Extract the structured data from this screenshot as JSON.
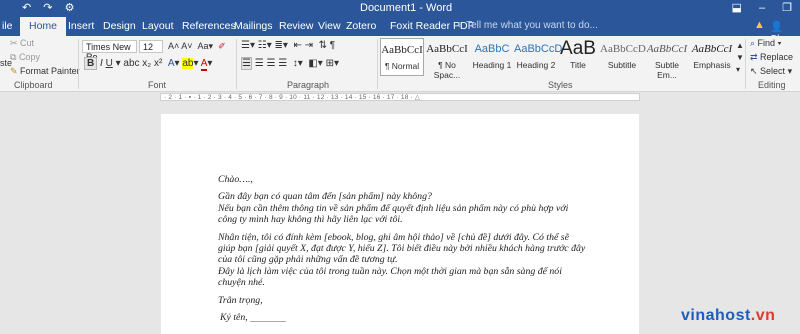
{
  "titlebar": {
    "document_title": "Document1 - Word",
    "quick_access": [
      "↶",
      "↷",
      "⚙"
    ],
    "window_controls": [
      "⬓",
      "–",
      "❐"
    ]
  },
  "tabs": {
    "items": [
      "ile",
      "Home",
      "Insert",
      "Design",
      "Layout",
      "References",
      "Mailings",
      "Review",
      "View",
      "Zotero",
      "Foxit Reader PDF"
    ],
    "active": "Home",
    "tell_me": "Tell me what you want to do...",
    "share": "Shar"
  },
  "clipboard": {
    "paste_fragment": "ste",
    "cut": "Cut",
    "copy": "Copy",
    "format_painter": "Format Painter",
    "label": "Clipboard"
  },
  "font": {
    "name": "Times New Ro",
    "size": "12",
    "label": "Font"
  },
  "paragraph": {
    "label": "Paragraph"
  },
  "styles": {
    "label": "Styles",
    "items": [
      {
        "sample": "AaBbCcI",
        "name": "¶ Normal"
      },
      {
        "sample": "AaBbCcI",
        "name": "¶ No Spac..."
      },
      {
        "sample": "AaBbC",
        "name": "Heading 1"
      },
      {
        "sample": "AaBbCcD",
        "name": "Heading 2"
      },
      {
        "sample": "AaB",
        "name": "Title"
      },
      {
        "sample": "AaBbCcD",
        "name": "Subtitle"
      },
      {
        "sample": "AaBbCcI",
        "name": "Subtle Em..."
      },
      {
        "sample": "AaBbCcI",
        "name": "Emphasis"
      }
    ]
  },
  "editing": {
    "find": "Find",
    "replace": "Replace",
    "select": "Select",
    "label": "Editing"
  },
  "ruler": {
    "numbers": "· 2 · 1 · ▪ · 1 · 2 · 3 · 4 · 5 · 6 · 7 · 8 · 9 · 10 · 11 · 12 · 13 · 14 · 15 · 16 · 17 · 18 · △"
  },
  "document": {
    "greeting": "Chào….,",
    "p1_l1": "Gần đây bạn có quan tâm đến [sản phẩm] này không?",
    "p1_l2": "Nếu bạn cần thêm thông tin về sản phẩm để quyết định liệu sản phẩm này có phù hợp với",
    "p1_l3": "công ty mình hay không thì hãy liên lạc với tôi.",
    "p2_l1": "Nhân tiện, tôi có đính kèm [ebook, blog, ghi âm hội thảo] về [chủ đề] dưới đây. Có thể sẽ",
    "p2_l2": "giúp bạn [giải quyết X, đạt được Y, hiểu Z]. Tôi biết điều này bởi nhiều khách hàng trước đây",
    "p2_l3": "của tôi cũng gặp phải những vấn đề tương tự.",
    "p2_l4": "Đây là lịch làm việc của tôi trong tuần này. Chọn một thời gian mà bạn sẵn sàng để nói",
    "p2_l5": "chuyện nhé.",
    "closing": "Trân trọng,",
    "signature": "Ký tên,"
  },
  "watermark": {
    "text": "vinahost",
    "suffix": ".vn"
  },
  "colors": {
    "accent": "#2b579a",
    "ribbon": "#f3f3f3",
    "canvas": "#e6e6e6",
    "heading": "#2e74b5"
  }
}
